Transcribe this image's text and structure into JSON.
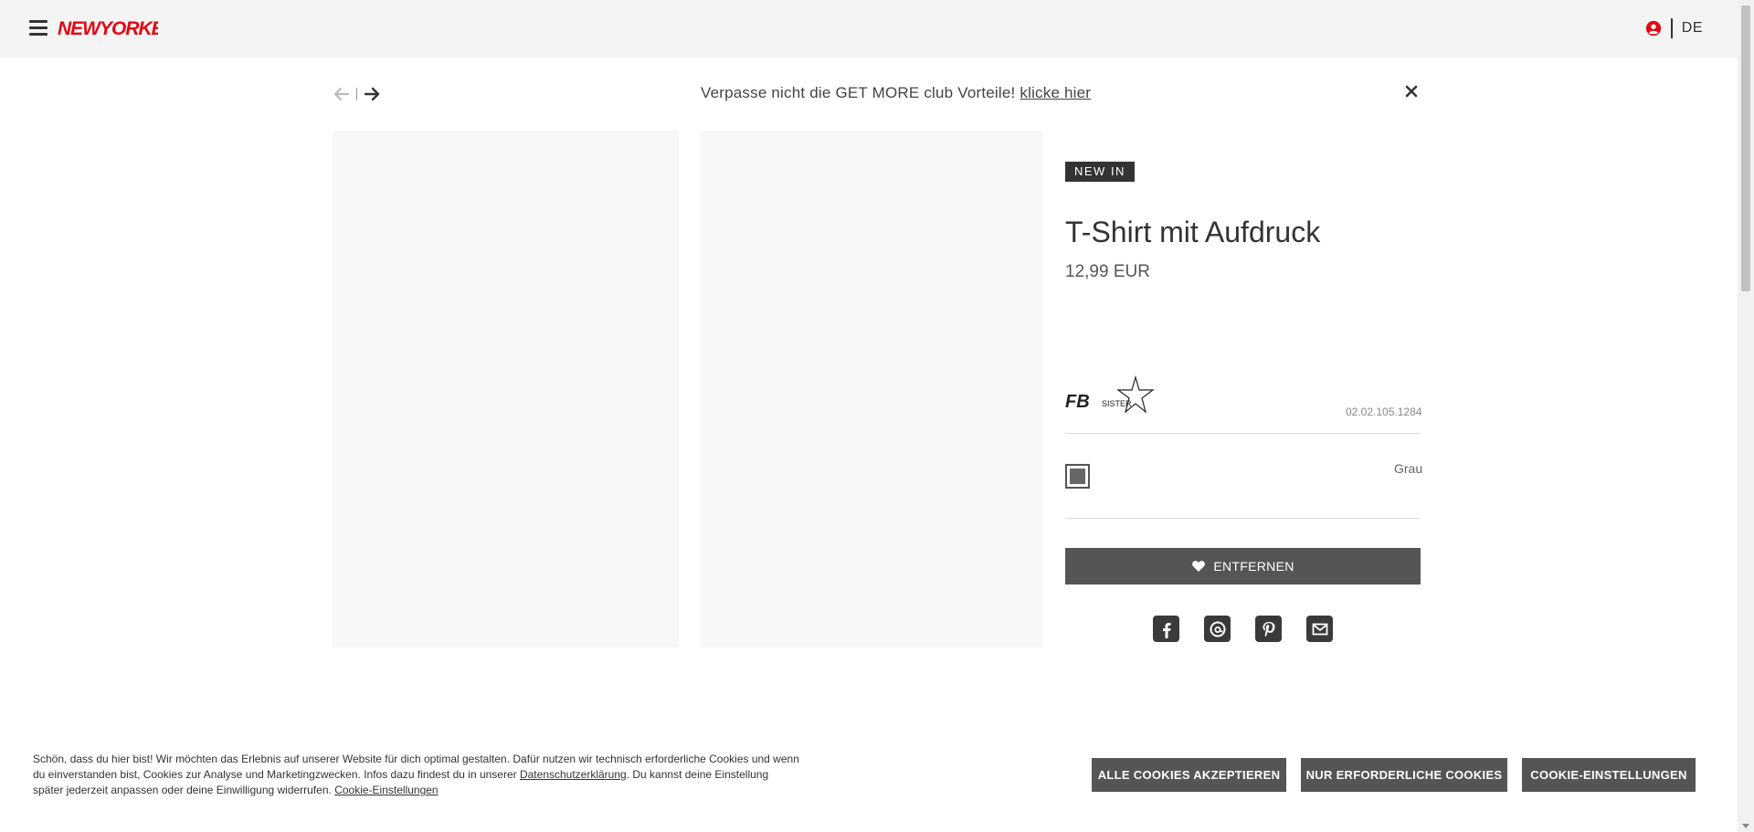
{
  "header": {
    "logo_text": "NEWYORKER",
    "language": "DE",
    "colors": {
      "brand": "#e30613",
      "header_bg": "#f4f4f4"
    }
  },
  "banner": {
    "text": "Verpasse nicht die GET MORE club Vorteile! ",
    "link": "klicke hier"
  },
  "product": {
    "badge": "NEW IN",
    "title": "T-Shirt mit Aufdruck",
    "price": "12,99 EUR",
    "brand_logo_text": "FB SISTER",
    "article_number": "02.02.105.1284",
    "color_name": "Grau",
    "color_hex": "#666666",
    "wishlist_button": "ENTFERNEN",
    "share_icons": [
      "facebook-icon",
      "threads-icon",
      "pinterest-icon",
      "email-icon"
    ]
  },
  "cookie": {
    "text_part1": "Schön, dass du hier bist! Wir möchten das Erlebnis auf unserer Website für dich optimal gestalten. Dafür nutzen wir technisch erforderliche Cookies und wenn du einverstanden bist, Cookies zur Analyse und Marketingzwecken. Infos dazu findest du in unserer ",
    "privacy_link": "Datenschutzerklärung",
    "text_part2": ". Du kannst deine Einstellung später jederzeit anpassen oder deine Einwilligung widerrufen. ",
    "settings_link": "Cookie-Einstellungen",
    "btn_accept_all": "ALLE COOKIES AKZEPTIEREN",
    "btn_required": "NUR ERFORDERLICHE COOKIES",
    "btn_settings": "COOKIE-EINSTELLUNGEN"
  }
}
